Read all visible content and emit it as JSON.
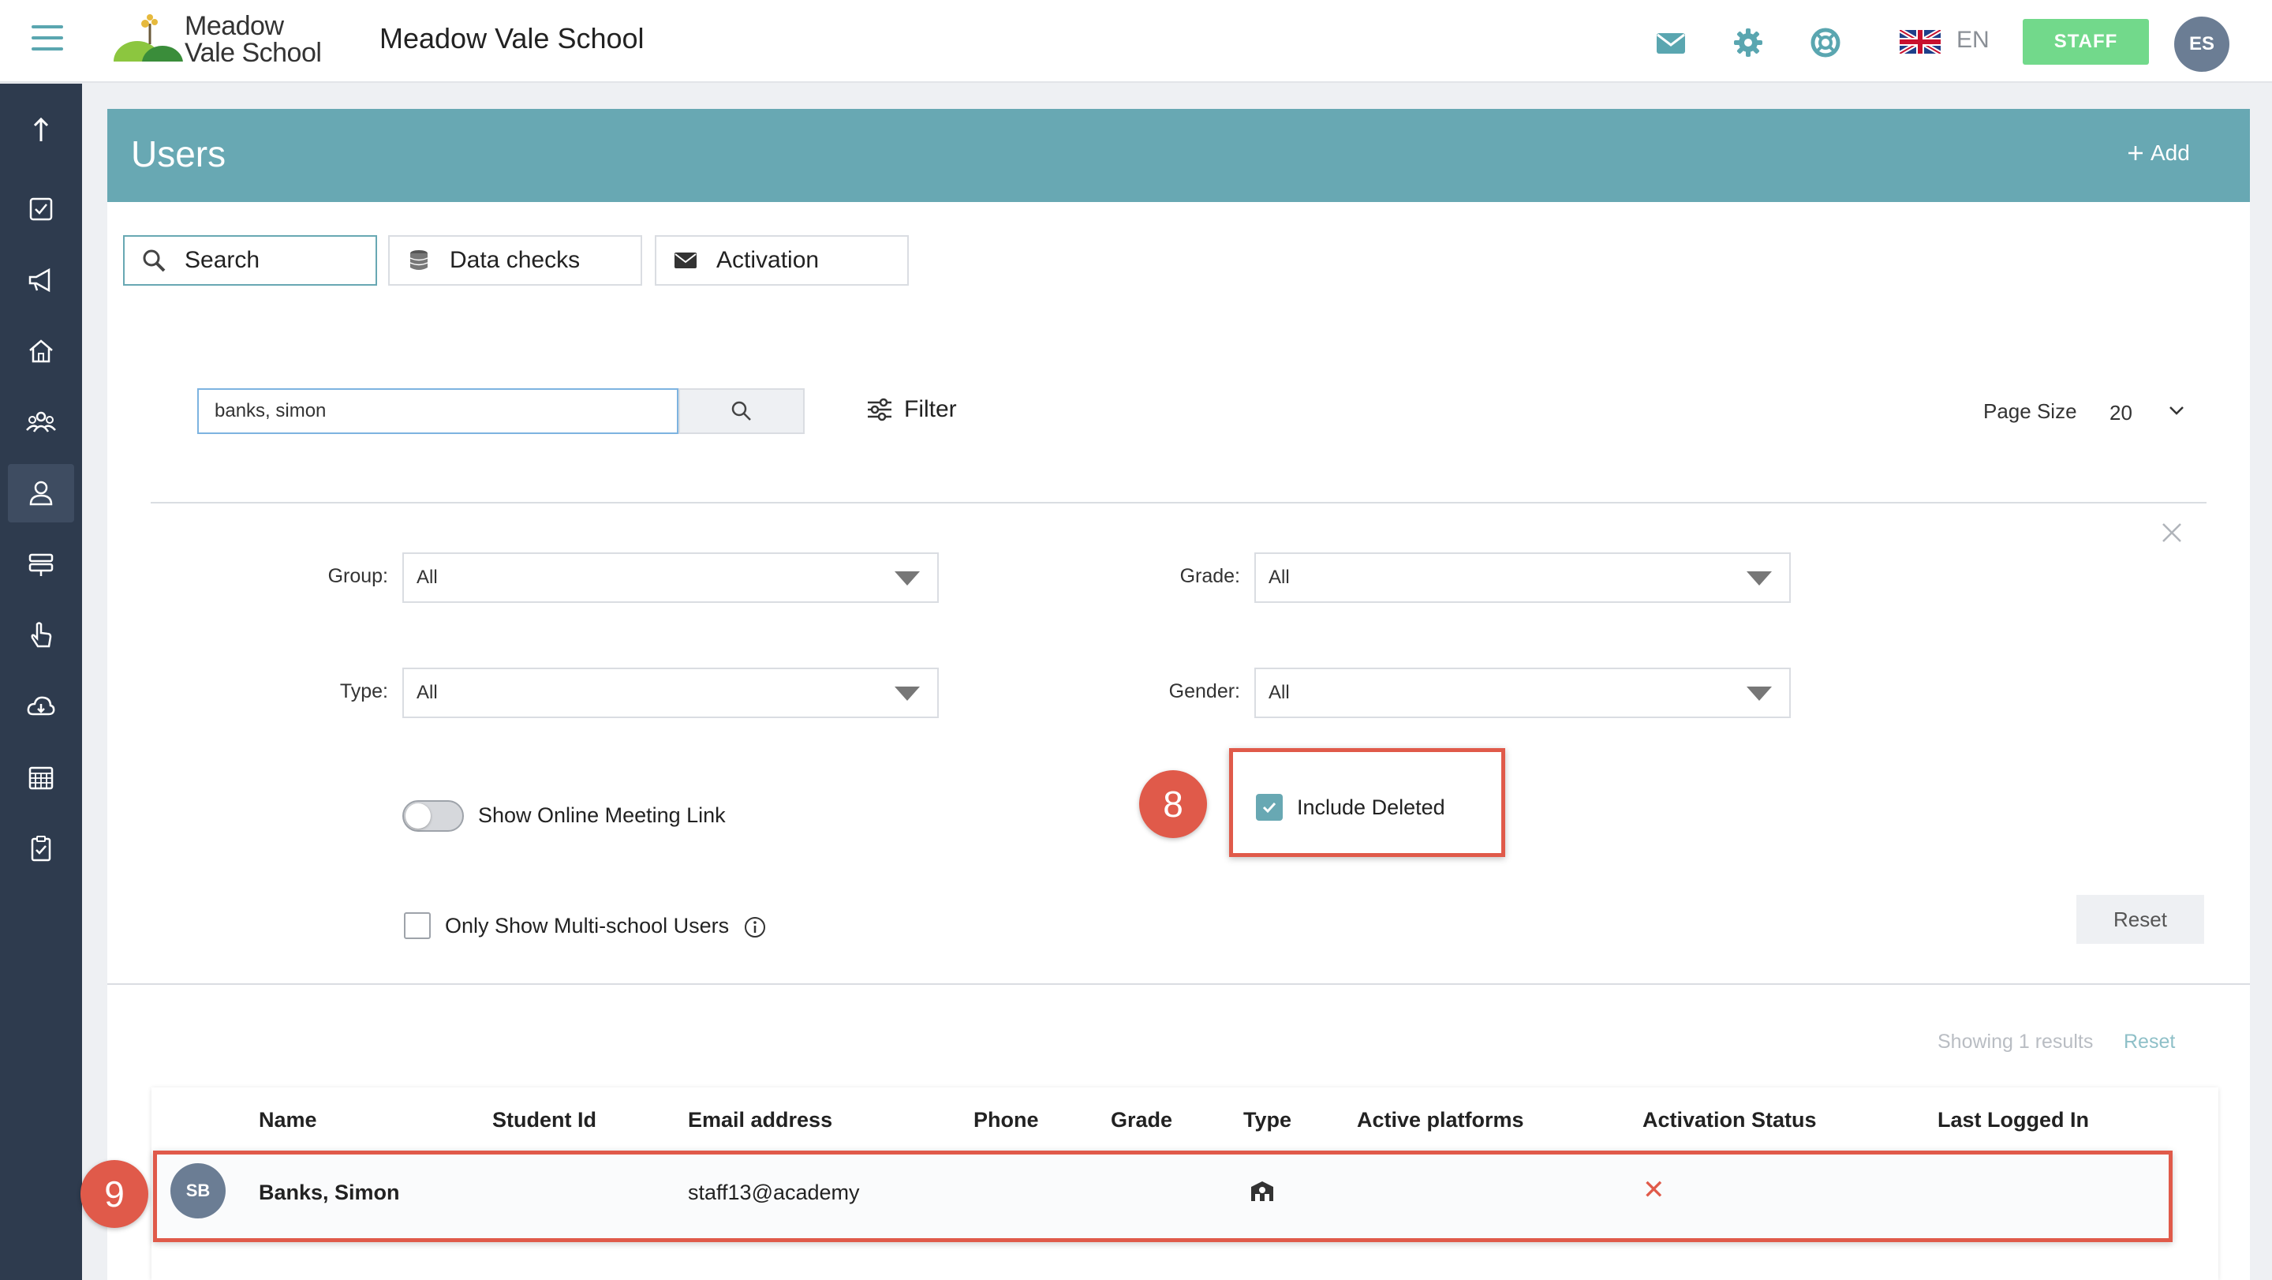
{
  "app": {
    "school_name": "Meadow Vale School",
    "logo_line1": "Meadow",
    "logo_line2": "Vale School",
    "language": "EN",
    "role_button": "STAFF",
    "user_initials": "ES"
  },
  "icons": {
    "top": [
      "mail-icon",
      "settings-icon",
      "help-icon",
      "uk-flag-icon"
    ],
    "sidebar": [
      "arrow-up-icon",
      "checklist-icon",
      "megaphone-icon",
      "home-icon",
      "groups-icon",
      "user-icon",
      "timetable-icon",
      "hand-pointer-icon",
      "cloud-download-icon",
      "calendar-icon",
      "clipboard-icon"
    ]
  },
  "colors": {
    "accent": "#68a8b3",
    "sidebar": "#2e3b4e",
    "staff": "#72d98b",
    "highlight": "#e05a4a"
  },
  "page": {
    "title": "Users",
    "add_label": "Add"
  },
  "tabs": [
    {
      "label": "Search",
      "active": true
    },
    {
      "label": "Data checks",
      "active": false
    },
    {
      "label": "Activation",
      "active": false
    }
  ],
  "search": {
    "value": "banks, simon",
    "filter_label": "Filter",
    "page_size_label": "Page Size",
    "page_size_value": "20"
  },
  "filters": {
    "group_label": "Group:",
    "group_value": "All",
    "grade_label": "Grade:",
    "grade_value": "All",
    "type_label": "Type:",
    "type_value": "All",
    "gender_label": "Gender:",
    "gender_value": "All",
    "online_meeting_label": "Show Online Meeting Link",
    "online_meeting_on": false,
    "include_deleted_label": "Include Deleted",
    "include_deleted_checked": true,
    "multi_school_label": "Only Show Multi-school Users",
    "multi_school_checked": false,
    "reset_label": "Reset"
  },
  "steps": {
    "step8": "8",
    "step9": "9"
  },
  "results": {
    "showing": "Showing 1 results",
    "reset_label": "Reset",
    "columns": [
      "Name",
      "Student Id",
      "Email address",
      "Phone",
      "Grade",
      "Type",
      "Active platforms",
      "Activation Status",
      "Last Logged In"
    ],
    "rows": [
      {
        "initials": "SB",
        "name": "Banks, Simon",
        "student_id": "",
        "email": "staff13@academy",
        "phone": "",
        "grade": "",
        "type_icon": "staff-icon",
        "active_platforms": "",
        "activation_status": "✕",
        "last_logged_in": ""
      }
    ]
  }
}
